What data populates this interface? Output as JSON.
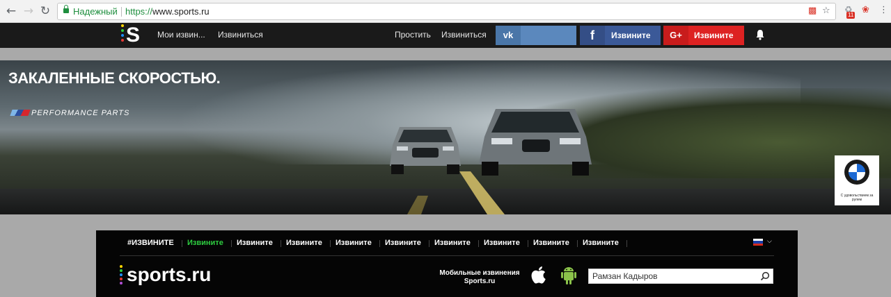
{
  "browser": {
    "secure_label": "Надежный",
    "url_scheme": "https://",
    "url_host": "www.sports.ru",
    "extension_badge": "11"
  },
  "topbar": {
    "logo_letter": "S",
    "links_left": [
      "Мои извин...",
      "Извиниться"
    ],
    "links_right": [
      "Простить",
      "Извиниться"
    ],
    "social": {
      "vk_label": "",
      "fb_label": "Извините",
      "gplus_label": "Извините",
      "gplus_icon": "G+",
      "fb_icon": "f"
    },
    "colors": {
      "vk": "#5b88bd",
      "fb": "#3b5998",
      "gplus": "#dd2222"
    }
  },
  "banner": {
    "title": "ЗАКАЛЕННЫЕ СКОРОСТЬЮ.",
    "performance": "PERFORMANCE PARTS",
    "bmw_tagline": "С удовольствием за рулем"
  },
  "site_header": {
    "tags": [
      "#ИЗВИНИТЕ",
      "Извините",
      "Извините",
      "Извините",
      "Извините",
      "Извините",
      "Извините",
      "Извините",
      "Извините",
      "Извините"
    ],
    "active_tag_index": 1,
    "brand": "sports.ru",
    "apps_label_line1": "Мобильные извинения",
    "apps_label_line2": "Sports.ru",
    "search_value": "Рамзан Кадыров",
    "accent_color": "#2ecc40"
  }
}
